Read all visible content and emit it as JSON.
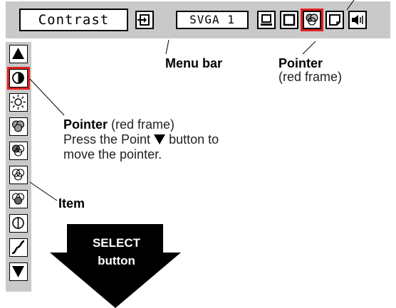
{
  "menu_bar": {
    "title": "Contrast",
    "source_label": "SVGA 1",
    "icons": [
      "input-select-icon",
      "source-icon",
      "pc-adjust-icon",
      "screen-icon",
      "image-adjust-icon",
      "setting-icon",
      "sound-icon"
    ]
  },
  "toolbar": {
    "items": [
      "scroll-up-arrow-icon",
      "contrast-icon",
      "brightness-icon",
      "color-temp-icon",
      "red-icon",
      "green-icon",
      "blue-icon",
      "sharpness-icon",
      "gamma-icon",
      "scroll-down-arrow-icon"
    ]
  },
  "callouts": {
    "menu_bar": "Menu bar",
    "pointer_top_title": "Pointer",
    "pointer_top_sub": "(red frame)",
    "pointer_left_title": "Pointer",
    "pointer_left_sub": "(red frame)",
    "pointer_left_line2a": "Press the Point",
    "pointer_left_line2b": "button to",
    "pointer_left_line3": "move the pointer.",
    "item": "Item",
    "select_line1": "SELECT",
    "select_line2": "button"
  },
  "colors": {
    "panel": "#c9c9c9",
    "pointer_frame": "#e02020",
    "arrow": "#000000"
  }
}
